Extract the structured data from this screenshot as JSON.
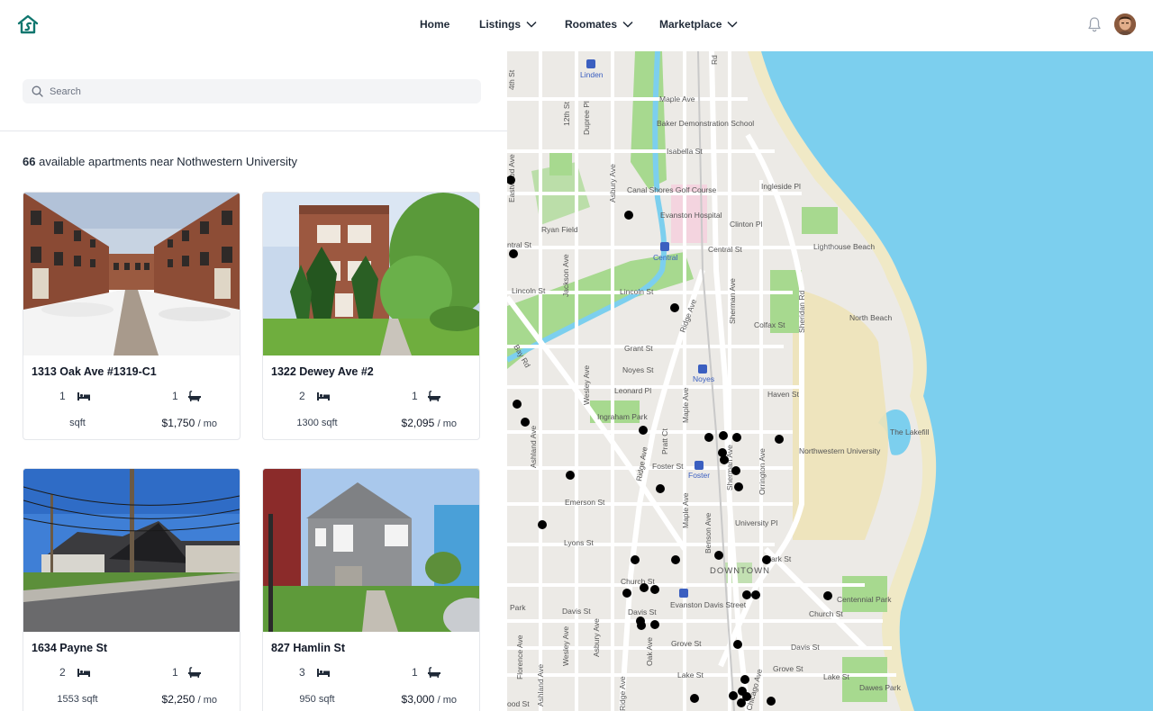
{
  "header": {
    "nav": [
      {
        "label": "Home",
        "dropdown": false
      },
      {
        "label": "Listings",
        "dropdown": true
      },
      {
        "label": "Roomates",
        "dropdown": true
      },
      {
        "label": "Marketplace",
        "dropdown": true
      }
    ],
    "icons": {
      "logo": "house-logo-icon",
      "notifications": "bell-icon",
      "profile": "avatar"
    }
  },
  "search": {
    "placeholder": "Search",
    "value": ""
  },
  "results": {
    "count": "66",
    "text": "available apartments near Nothwestern University"
  },
  "listings": [
    {
      "address": "1313 Oak Ave #1319-C1",
      "beds": "1",
      "baths": "1",
      "sqft": "sqft",
      "price": "$1,750",
      "per": "/ mo"
    },
    {
      "address": "1322 Dewey Ave #2",
      "beds": "2",
      "baths": "1",
      "sqft": "1300 sqft",
      "price": "$2,095",
      "per": "/ mo"
    },
    {
      "address": "1634 Payne St",
      "beds": "2",
      "baths": "1",
      "sqft": "1553 sqft",
      "price": "$2,250",
      "per": "/ mo"
    },
    {
      "address": "827 Hamlin St",
      "beds": "3",
      "baths": "1",
      "sqft": "950 sqft",
      "price": "$3,000",
      "per": "/ mo"
    }
  ],
  "map": {
    "labels": {
      "linden": "Linden",
      "maple_ave_n": "Maple Ave",
      "baker": "Baker Demonstration School",
      "isabella": "Isabella St",
      "ingleside": "Ingleside Pl",
      "canal": "Canal Shores Golf Course",
      "hospital": "Evanston Hospital",
      "ryan": "Ryan Field",
      "clinton": "Clinton Pl",
      "central_st": "Central St",
      "central_station": "Central",
      "lighthouse": "Lighthouse Beach",
      "ctral": "ntral St",
      "lincoln_w": "Lincoln St",
      "lincoln_e": "Lincoln St",
      "colfax": "Colfax St",
      "north_beach": "North Beach",
      "grant": "Grant St",
      "noyes_st": "Noyes St",
      "noyes_station": "Noyes",
      "leonard": "Leonard Pl",
      "haven": "Haven St",
      "ingraham": "Ingraham Park",
      "lakefill": "The Lakefill",
      "nu": "Northwestern University",
      "foster_st": "Foster St",
      "foster_station": "Foster",
      "emerson": "Emerson St",
      "university_pl": "University Pl",
      "lyons": "Lyons St",
      "clark": "Clark St",
      "downtown": "DOWNTOWN",
      "church_w": "Church St",
      "centennial": "Centennial Park",
      "davis_station": "Evanston Davis Street",
      "church_e": "Church St",
      "davis_w": "Davis St",
      "davis_c": "Davis St",
      "davis_e": "Davis St",
      "grove_w": "Grove St",
      "grove_e": "Grove St",
      "lake_w": "Lake St",
      "lake_e": "Lake St",
      "dawes": "Dawes Park",
      "ood": "ood St",
      "sheridan": "Sheridan Rd",
      "ridge_n": "Ridge Ave",
      "ridge_s": "Ridge Ave",
      "sherman_n": "Sherman Ave",
      "sherman_s": "Sherman Ave",
      "orrington": "Orrington Ave",
      "asbury_n": "Asbury Ave",
      "asbury_s": "Asbury Ave",
      "jackson": "Jackson Ave",
      "wesley_n": "Wesley Ave",
      "wesley_s": "Wesley Ave",
      "ashland_n": "Ashland Ave",
      "ashland_s": "Ashland Ave",
      "florence": "Florence Ave",
      "pratt": "Pratt Ct",
      "maple_n": "Maple Ave",
      "maple_s": "Maple Ave",
      "benson": "Benson Ave",
      "oak": "Oak Ave",
      "chicago": "Chicago Ave",
      "dupree": "Dupree Pl",
      "twelfth": "12th St",
      "fourteenth": "4th St",
      "fifteenth": "Eastwood Ave",
      "bay": "Bay Rd",
      "park": "Park",
      "ridge_lower": "Ridge Ave",
      "hinman": "Rd"
    }
  }
}
